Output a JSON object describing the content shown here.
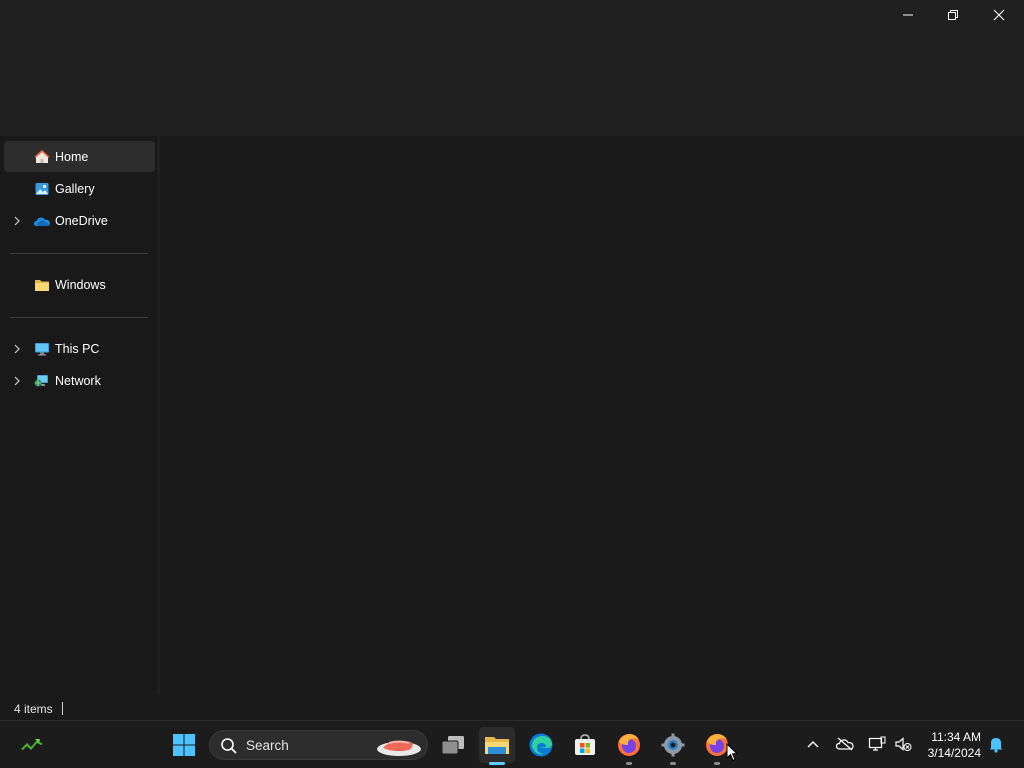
{
  "window": {
    "controls": [
      {
        "name": "minimize-button",
        "icon": "minimize-icon"
      },
      {
        "name": "restore-button",
        "icon": "restore-icon"
      },
      {
        "name": "close-button",
        "icon": "close-icon"
      }
    ]
  },
  "nav": {
    "items": [
      {
        "label": "Home",
        "icon": "home-icon",
        "selected": true,
        "expandable": false
      },
      {
        "label": "Gallery",
        "icon": "gallery-icon",
        "selected": false,
        "expandable": false
      },
      {
        "label": "OneDrive",
        "icon": "onedrive-icon",
        "selected": false,
        "expandable": true
      },
      {
        "label": "Windows",
        "icon": "folder-icon",
        "selected": false,
        "expandable": false
      },
      {
        "label": "This PC",
        "icon": "this-pc-icon",
        "selected": false,
        "expandable": true
      },
      {
        "label": "Network",
        "icon": "network-icon",
        "selected": false,
        "expandable": true
      }
    ]
  },
  "status": {
    "item_count": "4 items"
  },
  "taskbar": {
    "search_placeholder": "Search",
    "apps": [
      {
        "icon": "widgets-icon"
      },
      {
        "icon": "start-icon"
      },
      {
        "icon": "task-view-icon"
      },
      {
        "icon": "file-explorer-icon",
        "active": true,
        "running": true
      },
      {
        "icon": "edge-icon"
      },
      {
        "icon": "microsoft-store-icon"
      },
      {
        "icon": "firefox-icon",
        "running": true
      },
      {
        "icon": "settings-icon",
        "running": true
      },
      {
        "icon": "firefox-icon",
        "running": true
      }
    ],
    "tray": [
      "chevron-up-icon",
      "onedrive-offline-icon",
      "network-icon",
      "volume-muted-icon"
    ],
    "time": "11:34 AM",
    "date": "3/14/2024",
    "notification_icon": "bell-icon"
  },
  "colors": {
    "accent": "#60cdff",
    "background": "#191919",
    "titlebar": "#202020",
    "selected": "#2d2d2d"
  }
}
